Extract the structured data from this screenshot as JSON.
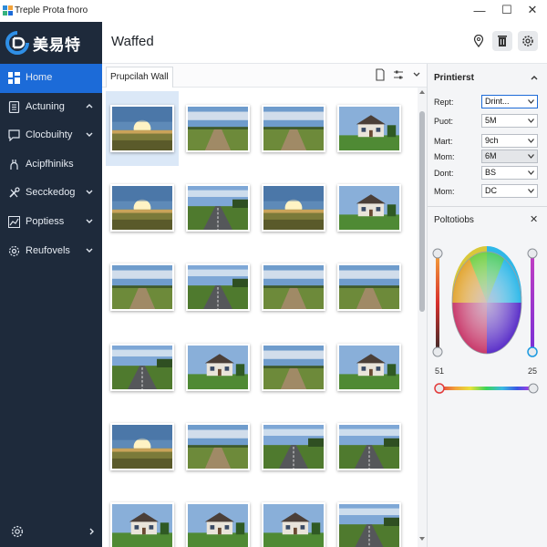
{
  "window": {
    "title": "Treple Prota fnoro",
    "controls": {
      "minimize": "—",
      "maximize": "☐",
      "close": "✕"
    }
  },
  "sidebar": {
    "brand": "美易特",
    "items": [
      {
        "label": "Home",
        "icon": "grid-icon",
        "active": true,
        "chevron": false
      },
      {
        "label": "Actuning",
        "icon": "document-icon",
        "active": false,
        "chevron": "up"
      },
      {
        "label": "Clocbuihty",
        "icon": "chat-icon",
        "active": false,
        "chevron": "down"
      },
      {
        "label": "Acipfhiniks",
        "icon": "plug-icon",
        "active": false,
        "chevron": false
      },
      {
        "label": "Secckedog",
        "icon": "tools-icon",
        "active": false,
        "chevron": "down"
      },
      {
        "label": "Poptiess",
        "icon": "chart-icon",
        "active": false,
        "chevron": "down"
      },
      {
        "label": "Reufovels",
        "icon": "gear-icon",
        "active": false,
        "chevron": "down"
      }
    ]
  },
  "header": {
    "title": "Waffed",
    "buttons": [
      "location-pin-icon",
      "trash-icon",
      "settings-icon"
    ]
  },
  "gallery": {
    "tab_label": "Prupcilah Wall",
    "selected_index": 0,
    "thumbnails": [
      "sunset-field",
      "dirt-road",
      "dirt-road",
      "farmhouse",
      "sunset-field",
      "road",
      "sunset-field",
      "farmhouse",
      "dirt-road",
      "road",
      "dirt-road",
      "dirt-road",
      "road",
      "farmhouse",
      "dirt-road",
      "farmhouse",
      "sunset-field",
      "dirt-road",
      "road",
      "road",
      "farmhouse",
      "farmhouse",
      "farmhouse",
      "road"
    ]
  },
  "properties": {
    "title": "Printierst",
    "rows": [
      {
        "label": "Rept:",
        "value": "Drint...",
        "state": "focused"
      },
      {
        "label": "Puot:",
        "value": "5M",
        "state": "normal"
      },
      {
        "label": "Mart:",
        "value": "9ch",
        "state": "normal"
      },
      {
        "label": "Mom:",
        "value": "6M",
        "state": "disabled"
      },
      {
        "label": "Dont:",
        "value": "BS",
        "state": "normal"
      },
      {
        "label": "Mom:",
        "value": "DC",
        "state": "normal"
      }
    ]
  },
  "color_panel": {
    "title": "Poltotiobs",
    "left_value": "51",
    "right_value": "25",
    "close": "✕"
  },
  "colors": {
    "sidebar_bg": "#1e2a3b",
    "accent": "#1c6bd8",
    "panel_bg": "#f4f5f7"
  }
}
